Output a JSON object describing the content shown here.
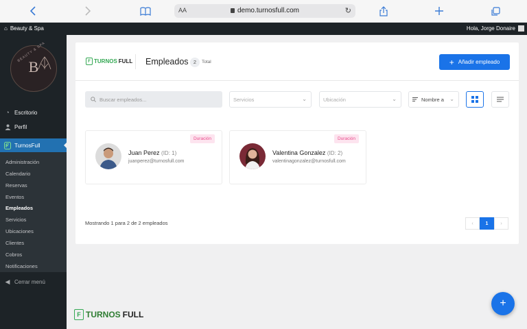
{
  "browser": {
    "aa": "AA",
    "url": "demo.turnosfull.com"
  },
  "adminbar": {
    "site_name": "Beauty & Spa",
    "greeting": "Hola, Jorge Donaire"
  },
  "sidebar": {
    "logo_letter": "B",
    "logo_arc": "BEAUTY & SPA",
    "items": [
      {
        "label": "Escritorio",
        "icon": "dashboard-icon"
      },
      {
        "label": "Perfil",
        "icon": "user-icon"
      }
    ],
    "active_group": "TurnosFull",
    "submenu": [
      "Administración",
      "Calendario",
      "Reservas",
      "Eventos",
      "Empleados",
      "Servicios",
      "Ubicaciones",
      "Clientes",
      "Cobros",
      "Notificaciones"
    ],
    "current": "Empleados",
    "collapse_label": "Cerrar menú"
  },
  "brand": {
    "prefix": "TURNOS",
    "suffix": "FULL",
    "icon_letter": "F",
    "color": "#34a853"
  },
  "header": {
    "title": "Empleados",
    "count": "2",
    "count_label": "Total",
    "add_button": "Añadir empleado",
    "add_icon": "plus-icon"
  },
  "filters": {
    "search_placeholder": "Buscar empleados...",
    "services_placeholder": "Servicios",
    "location_placeholder": "Ubicación",
    "sort_value": "Nombre a"
  },
  "employees": [
    {
      "name": "Juan Perez",
      "id": "(ID: 1)",
      "email": "juanperez@turnosfull.com",
      "tag": "Duración"
    },
    {
      "name": "Valentina Gonzalez",
      "id": "(ID: 2)",
      "email": "valentinagonzalez@turnosfull.com",
      "tag": "Duración"
    }
  ],
  "footer": {
    "showing": "Mostrando 1 para 2 de 2 empleados",
    "page": "1",
    "prev": "‹",
    "next": "›"
  },
  "fab": "+",
  "colors": {
    "primary": "#1a73e8",
    "sidebar": "#1d2327",
    "active": "#2271b1",
    "tag_bg": "#fde4ef",
    "tag_text": "#e94a8a"
  }
}
